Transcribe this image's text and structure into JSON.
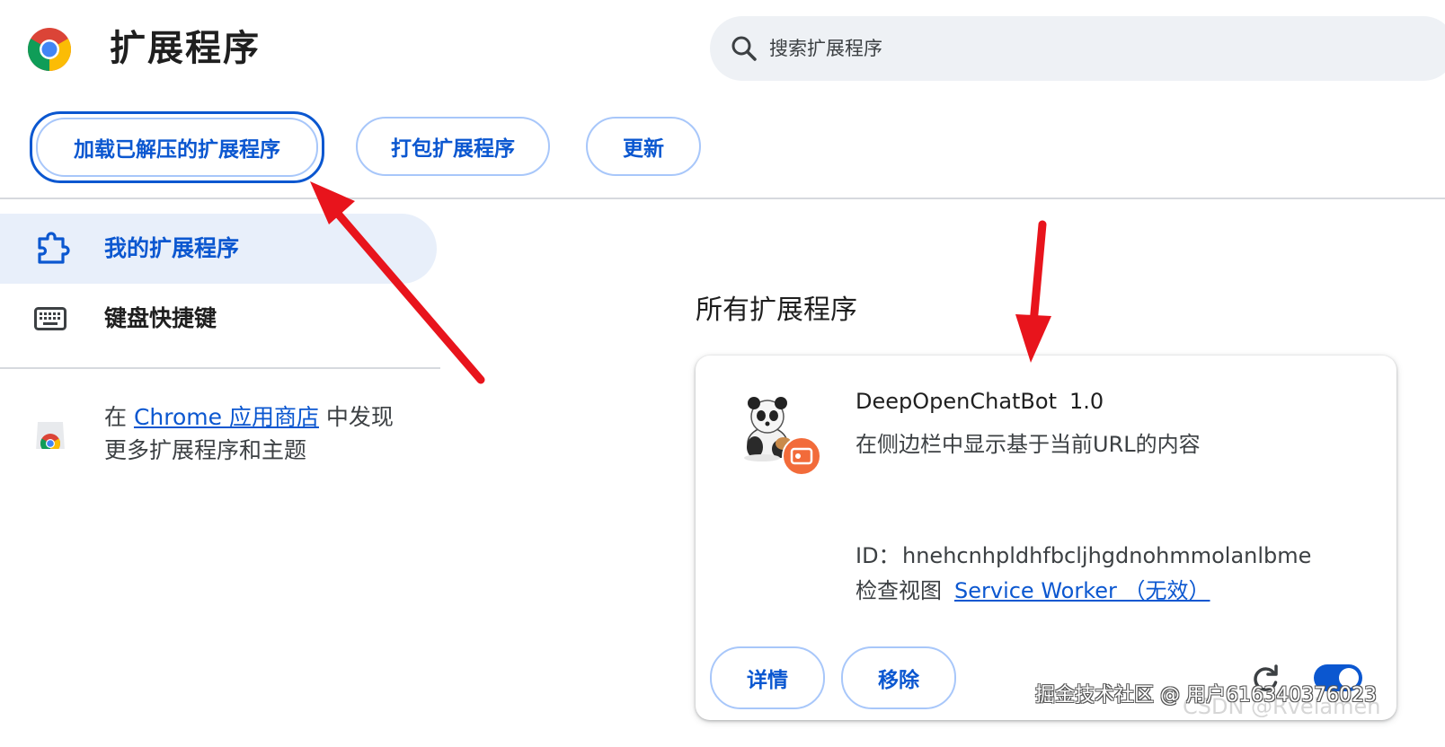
{
  "header": {
    "title": "扩展程序",
    "search_placeholder": "搜索扩展程序"
  },
  "toolbar": {
    "load_unpacked": "加载已解压的扩展程序",
    "pack_extension": "打包扩展程序",
    "update": "更新"
  },
  "sidebar": {
    "items": [
      {
        "label": "我的扩展程序",
        "icon": "puzzle-icon",
        "selected": true
      },
      {
        "label": "键盘快捷键",
        "icon": "keyboard-icon",
        "selected": false
      }
    ],
    "webstore": {
      "prefix": "在 ",
      "link": "Chrome 应用商店",
      "suffix": " 中发现更多扩展程序和主题"
    }
  },
  "main": {
    "heading": "所有扩展程序",
    "extension": {
      "name": "DeepOpenChatBot",
      "version": "1.0",
      "description": "在侧边栏中显示基于当前URL的内容",
      "id_label": "ID：",
      "id": "hnehcnhpldhfbcljhgdnohmmolanlbme",
      "inspect_label": "检查视图",
      "service_worker_link": "Service Worker （无效）",
      "details_button": "详情",
      "remove_button": "移除",
      "enabled": true
    }
  },
  "watermarks": {
    "juejin": "掘金技术社区 @ 用户6163403760​23",
    "csdn": "CSDN @Rvelamen"
  },
  "colors": {
    "accent": "#0b57d0",
    "annotation_arrow": "#e8141c"
  }
}
